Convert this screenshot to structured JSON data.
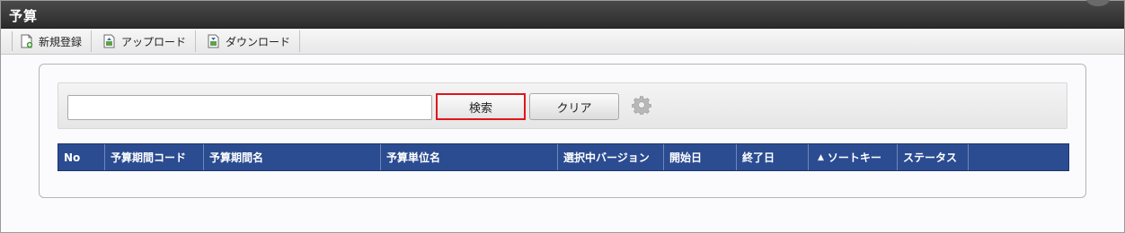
{
  "window": {
    "title": "予算"
  },
  "toolbar": {
    "items": [
      {
        "label": "新規登録",
        "icon": "new-document-icon"
      },
      {
        "label": "アップロード",
        "icon": "upload-icon"
      },
      {
        "label": "ダウンロード",
        "icon": "download-icon"
      }
    ]
  },
  "search": {
    "input_value": "",
    "input_placeholder": "",
    "search_label": "検索",
    "clear_label": "クリア",
    "settings_icon": "gear-icon"
  },
  "table": {
    "columns": [
      {
        "label": "No"
      },
      {
        "label": "予算期間コード"
      },
      {
        "label": "予算期間名"
      },
      {
        "label": "予算単位名"
      },
      {
        "label": "選択中バージョン"
      },
      {
        "label": "開始日"
      },
      {
        "label": "終了日"
      },
      {
        "label": "ソートキー",
        "sort_indicator": "▲"
      },
      {
        "label": "ステータス"
      },
      {
        "label": ""
      }
    ],
    "rows": []
  },
  "colors": {
    "header_bg": "#2b4c91",
    "titlebar_bg": "#2b2b2b",
    "search_highlight": "#e0151b"
  }
}
